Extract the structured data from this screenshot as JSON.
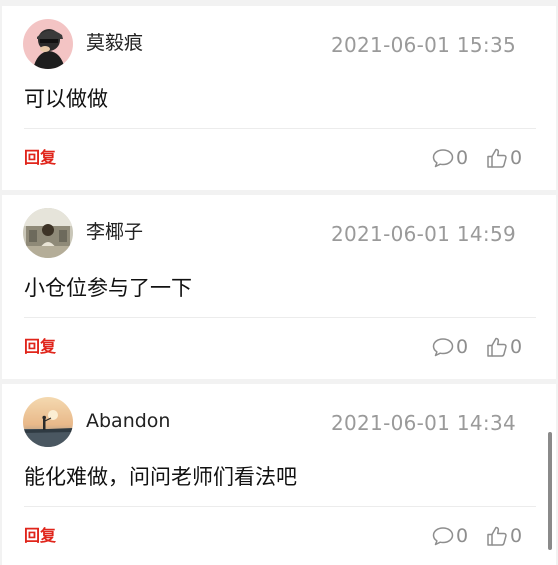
{
  "comments": [
    {
      "username": "莫毅痕",
      "time": "2021-06-01 15:35",
      "content": "可以做做",
      "reply_label": "回复",
      "comment_count": "0",
      "like_count": "0"
    },
    {
      "username": "李椰子",
      "time": "2021-06-01 14:59",
      "content": "小仓位参与了一下",
      "reply_label": "回复",
      "comment_count": "0",
      "like_count": "0"
    },
    {
      "username": "Abandon",
      "time": "2021-06-01 14:34",
      "content": "能化难做，问问老师们看法吧",
      "reply_label": "回复",
      "comment_count": "0",
      "like_count": "0"
    }
  ],
  "colors": {
    "reply": "#e0251b",
    "time": "#9a9a9a",
    "stat": "#8e8e8e",
    "separator": "#f2f2f2"
  },
  "icons": {
    "comment": "speech-bubble-icon",
    "like": "thumbs-up-icon"
  }
}
